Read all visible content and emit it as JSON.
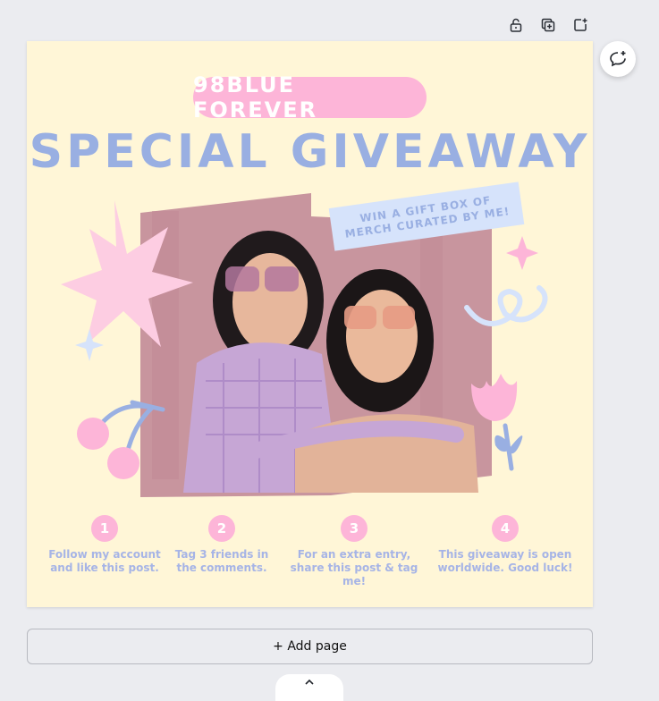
{
  "toolbar": {
    "lock_icon": "lock-icon",
    "duplicate_icon": "duplicate-page-icon",
    "add_icon": "add-page-icon",
    "comment_icon": "add-comment-icon"
  },
  "design": {
    "badge": "98BLUE FOREVER",
    "headline": "SPECIAL GIVEAWAY",
    "prize_line1": "WIN A GIFT BOX OF",
    "prize_line2": "MERCH CURATED BY ME!",
    "steps": [
      {
        "num": "1",
        "line1": "Follow my account",
        "line2": "and like this post."
      },
      {
        "num": "2",
        "line1": "Tag 3 friends in",
        "line2": "the comments."
      },
      {
        "num": "3",
        "line1": "For an extra entry,",
        "line2": "share this post & tag me!"
      },
      {
        "num": "4",
        "line1": "This giveaway is open",
        "line2": "worldwide. Good luck!"
      }
    ],
    "colors": {
      "background": "#fff6d7",
      "pink": "#fdb5d8",
      "blue": "#99afe2",
      "light_blue": "#d6e3fb"
    }
  },
  "footer": {
    "add_page_label": "+ Add page",
    "collapse_icon": "chevron-up-icon"
  }
}
